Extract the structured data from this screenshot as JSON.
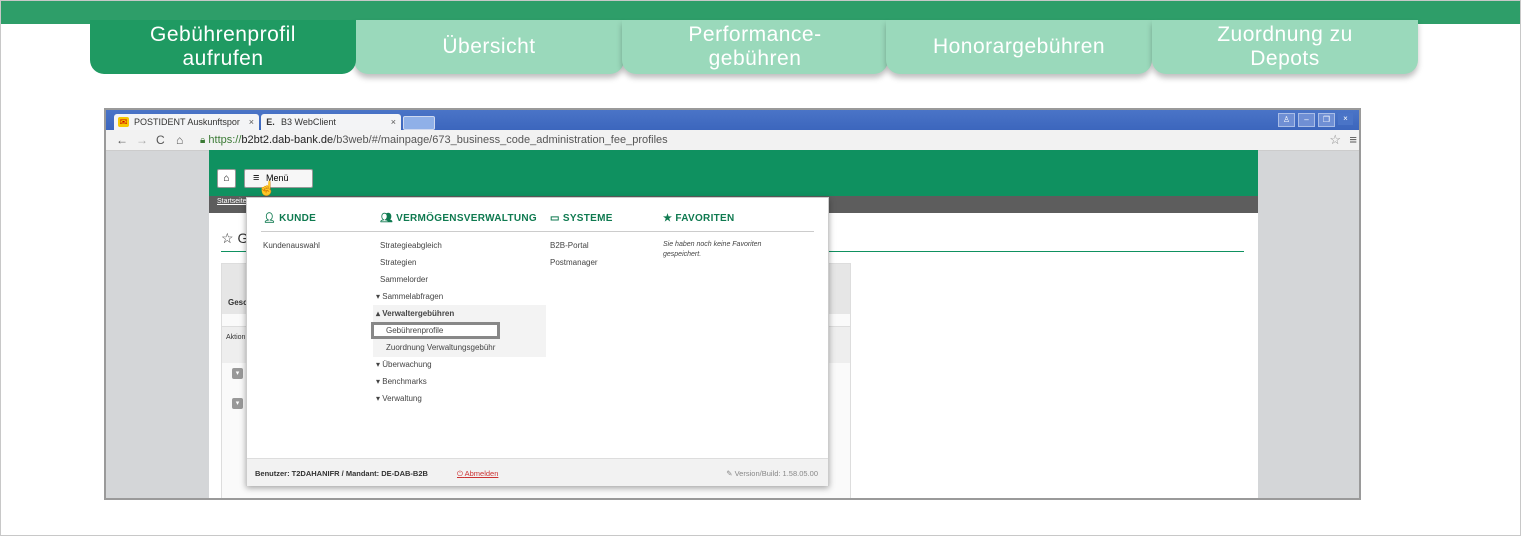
{
  "steps": [
    {
      "label": "Gebührenprofil aufrufen"
    },
    {
      "label": "Übersicht"
    },
    {
      "label": "Performance-gebühren"
    },
    {
      "label": "Honorargebühren"
    },
    {
      "label": "Zuordnung zu Depots"
    }
  ],
  "browser": {
    "tabs": [
      {
        "label": "POSTIDENT Auskunftspor",
        "close": "×",
        "icon": "postident-icon"
      },
      {
        "label": "B3 WebClient",
        "close": "×",
        "icon": "b3-icon"
      }
    ],
    "url_scheme": "https://",
    "url_host": "b2bt2.dab-bank.de",
    "url_path": "/b3web/#/mainpage/673_business_code_administration_fee_profiles"
  },
  "app": {
    "menu_button": "Menü",
    "breadcrumb": "Startseite",
    "bg_title": "☆ G",
    "bg_gesc": "Gesc",
    "bg_aktion": "Aktion"
  },
  "menu": {
    "kunde": {
      "header": "KUNDE",
      "items": [
        "Kundenauswahl"
      ]
    },
    "verm": {
      "header": "VERMÖGENSVERWALTUNG",
      "items": [
        {
          "label": "Strategieabgleich"
        },
        {
          "label": "Strategien"
        },
        {
          "label": "Sammelorder"
        },
        {
          "label": "▾ Sammelabfragen"
        },
        {
          "label": "▴ Verwaltergebühren"
        },
        {
          "label": "Gebührenprofile"
        },
        {
          "label": "Zuordnung Verwaltungsgebühr"
        },
        {
          "label": "▾ Überwachung"
        },
        {
          "label": "▾ Benchmarks"
        },
        {
          "label": "▾ Verwaltung"
        }
      ]
    },
    "systeme": {
      "header": "SYSTEME",
      "items": [
        "B2B-Portal",
        "Postmanager"
      ]
    },
    "favoriten": {
      "header": "FAVORITEN",
      "empty": "Sie haben noch keine Favoriten gespeichert."
    },
    "footer": {
      "user": "Benutzer: T2DAHANIFR / Mandant: DE-DAB-B2B",
      "logout": "Abmelden",
      "version": "Version/Build: 1.58.05.00"
    }
  },
  "colors": {
    "brand_green": "#0f9160",
    "step_active": "#1f9a62",
    "step_inactive": "#9ad9bb"
  }
}
